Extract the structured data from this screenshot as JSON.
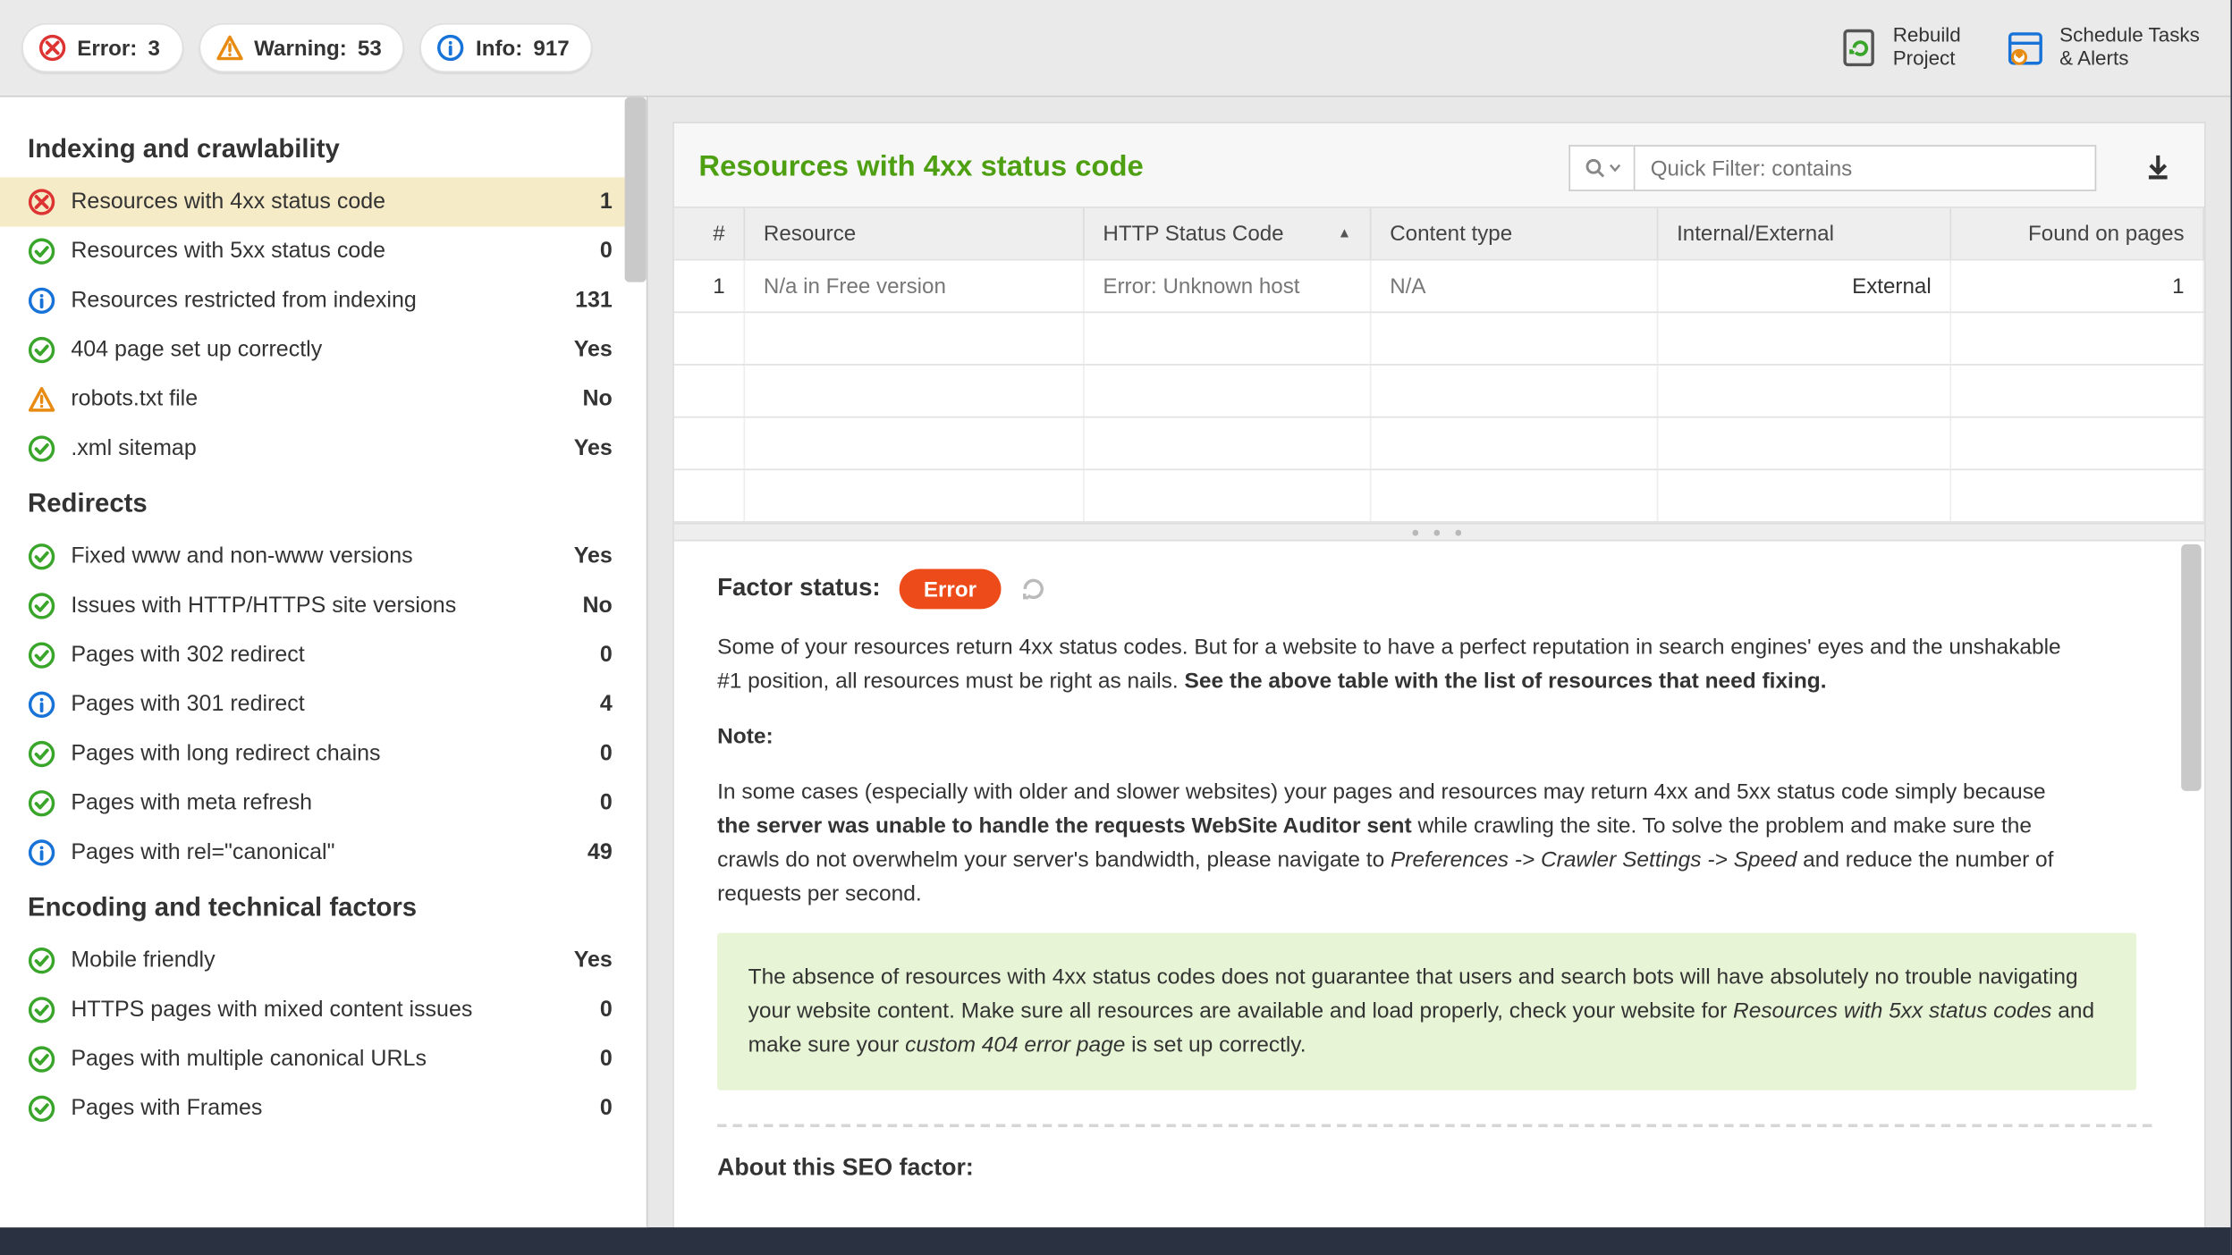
{
  "topbar": {
    "badges": [
      {
        "label": "Error:",
        "count": "3",
        "icon": "error"
      },
      {
        "label": "Warning:",
        "count": "53",
        "icon": "warning"
      },
      {
        "label": "Info:",
        "count": "917",
        "icon": "info"
      }
    ],
    "actions": {
      "rebuild_l1": "Rebuild",
      "rebuild_l2": "Project",
      "schedule_l1": "Schedule Tasks",
      "schedule_l2": "& Alerts"
    }
  },
  "sidebar": {
    "sections": [
      {
        "title": "Indexing and crawlability",
        "items": [
          {
            "icon": "error",
            "label": "Resources with 4xx status code",
            "value": "1",
            "selected": true
          },
          {
            "icon": "ok",
            "label": "Resources with 5xx status code",
            "value": "0"
          },
          {
            "icon": "info",
            "label": "Resources restricted from indexing",
            "value": "131"
          },
          {
            "icon": "ok",
            "label": "404 page set up correctly",
            "value": "Yes"
          },
          {
            "icon": "warning",
            "label": "robots.txt file",
            "value": "No"
          },
          {
            "icon": "ok",
            "label": ".xml sitemap",
            "value": "Yes"
          }
        ]
      },
      {
        "title": "Redirects",
        "items": [
          {
            "icon": "ok",
            "label": "Fixed www and non-www versions",
            "value": "Yes"
          },
          {
            "icon": "ok",
            "label": "Issues with HTTP/HTTPS site versions",
            "value": "No"
          },
          {
            "icon": "ok",
            "label": "Pages with 302 redirect",
            "value": "0"
          },
          {
            "icon": "info",
            "label": "Pages with 301 redirect",
            "value": "4"
          },
          {
            "icon": "ok",
            "label": "Pages with long redirect chains",
            "value": "0"
          },
          {
            "icon": "ok",
            "label": "Pages with meta refresh",
            "value": "0"
          },
          {
            "icon": "info",
            "label": "Pages with rel=\"canonical\"",
            "value": "49"
          }
        ]
      },
      {
        "title": "Encoding and technical factors",
        "items": [
          {
            "icon": "ok",
            "label": "Mobile friendly",
            "value": "Yes"
          },
          {
            "icon": "ok",
            "label": "HTTPS pages with mixed content issues",
            "value": "0"
          },
          {
            "icon": "ok",
            "label": "Pages with multiple canonical URLs",
            "value": "0"
          },
          {
            "icon": "ok",
            "label": "Pages with Frames",
            "value": "0"
          }
        ]
      }
    ]
  },
  "panel": {
    "title": "Resources with 4xx status code",
    "filter_placeholder": "Quick Filter: contains",
    "table": {
      "headers": [
        "#",
        "Resource",
        "HTTP Status Code",
        "Content type",
        "Internal/External",
        "Found on pages"
      ],
      "rows": [
        {
          "idx": "1",
          "resource": "N/a in Free version",
          "status": "Error: Unknown host",
          "ctype": "N/A",
          "ie": "External",
          "found": "1"
        }
      ]
    }
  },
  "detail": {
    "status_label": "Factor status:",
    "status_value": "Error",
    "p1a": "Some of your resources return 4xx status codes. But for a website to have a perfect reputation in search engines' eyes and the unshakable #1 position, all resources must be right as nails. ",
    "p1b": "See the above table with the list of resources that need fixing.",
    "note_label": "Note:",
    "p2a": "In some cases (especially with older and slower websites) your pages and resources may return 4xx and 5xx status code simply because ",
    "p2b": "the server was unable to handle the requests WebSite Auditor sent",
    "p2c": " while crawling the site. To solve the problem and make sure the crawls do not overwhelm your server's bandwidth, please navigate to ",
    "p2d": "Preferences -> Crawler Settings -> Speed",
    "p2e": " and reduce the number of requests per second.",
    "tip_a": "The absence of resources with 4xx status codes does not guarantee that users and search bots will have absolutely no trouble navigating your website content. Make sure all resources are available and load properly, check your website for ",
    "tip_b": "Resources with 5xx status codes",
    "tip_c": " and make sure your ",
    "tip_d": "custom 404 error page",
    "tip_e": " is set up correctly.",
    "about_title": "About this SEO factor:"
  }
}
